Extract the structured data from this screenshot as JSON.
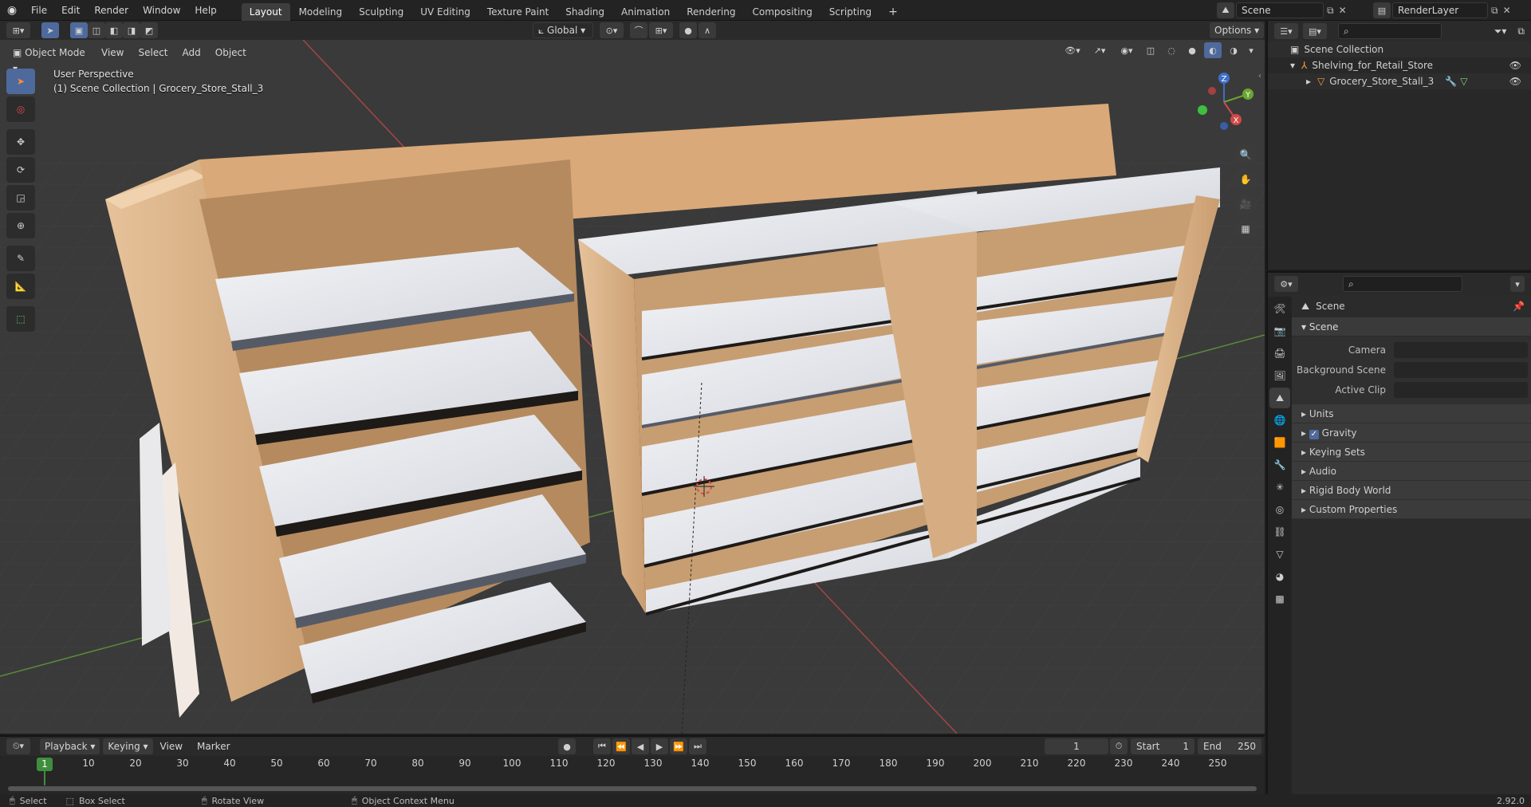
{
  "menubar": {
    "menus": [
      "File",
      "Edit",
      "Render",
      "Window",
      "Help"
    ],
    "workspaces": [
      "Layout",
      "Modeling",
      "Sculpting",
      "UV Editing",
      "Texture Paint",
      "Shading",
      "Animation",
      "Rendering",
      "Compositing",
      "Scripting"
    ],
    "active_workspace": "Layout",
    "scene": "Scene",
    "view_layer": "RenderLayer"
  },
  "toolbar": {
    "transform_orientation": "Global",
    "options_label": "Options"
  },
  "header3d": {
    "mode": "Object Mode",
    "menus": [
      "View",
      "Select",
      "Add",
      "Object"
    ]
  },
  "viewport": {
    "view_name": "User Perspective",
    "collection_info": "(1) Scene Collection | Grocery_Store_Stall_3",
    "axes": {
      "x": "X",
      "y": "Y",
      "z": "Z"
    }
  },
  "outliner": {
    "root": "Scene Collection",
    "items": [
      {
        "label": "Shelving_for_Retail_Store",
        "depth": 1
      },
      {
        "label": "Grocery_Store_Stall_3",
        "depth": 2
      }
    ]
  },
  "properties": {
    "title": "Scene",
    "scene_panel": {
      "title": "Scene",
      "camera_label": "Camera",
      "background_label": "Background Scene",
      "clip_label": "Active Clip"
    },
    "sections": [
      "Units",
      "Gravity",
      "Keying Sets",
      "Audio",
      "Rigid Body World",
      "Custom Properties"
    ],
    "gravity_checked": true
  },
  "timeline": {
    "menus": [
      "Playback",
      "Keying",
      "View",
      "Marker"
    ],
    "current_frame": "1",
    "start_label": "Start",
    "start": "1",
    "end_label": "End",
    "end": "250",
    "ticks": [
      "10",
      "20",
      "30",
      "40",
      "50",
      "60",
      "70",
      "80",
      "90",
      "100",
      "110",
      "120",
      "130",
      "140",
      "150",
      "160",
      "170",
      "180",
      "190",
      "200",
      "210",
      "220",
      "230",
      "240",
      "250"
    ],
    "playhead": "1"
  },
  "statusbar": {
    "select": "Select",
    "box_select": "Box Select",
    "rotate_view": "Rotate View",
    "context_menu": "Object Context Menu",
    "version": "2.92.0"
  },
  "colors": {
    "accent": "#4e6a9c",
    "wood": "#d9b088",
    "shelf": "#e8eaee",
    "playhead": "#3e8e3e"
  }
}
